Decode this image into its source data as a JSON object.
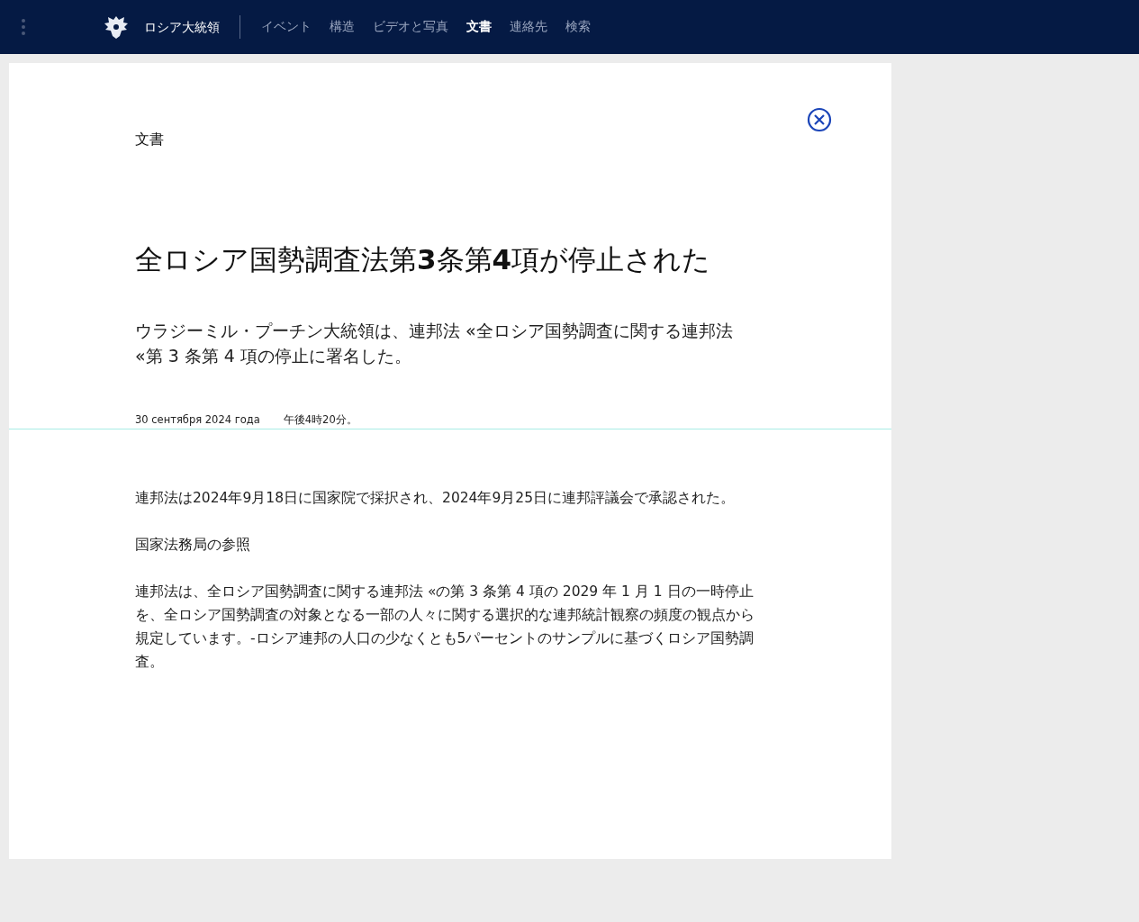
{
  "header": {
    "site_title": "ロシア大統領",
    "nav": [
      {
        "label": "イベント",
        "selected": false
      },
      {
        "label": "構造",
        "selected": false
      },
      {
        "label": "ビデオと写真",
        "selected": false
      },
      {
        "label": "文書",
        "selected": true
      },
      {
        "label": "連絡先",
        "selected": false
      },
      {
        "label": "検索",
        "selected": false
      }
    ]
  },
  "article": {
    "section": "文書",
    "title": "全ロシア国勢調査法第**3**条第**4**項が停止された",
    "lead": "ウラジーミル・プーチン大統領は、連邦法 «全ロシア国勢調査に関する連邦法 «第 3 条第 4 項の停止に署名した。",
    "date": "30 сентября 2024 года",
    "time": "午後4時20分。",
    "paragraphs": [
      "連邦法は2024年9月18日に国家院で採択され、2024年9月25日に連邦評議会で承認された。",
      "国家法務局の参照",
      "連邦法は、全ロシア国勢調査に関する連邦法 «の第 3 条第 4 項の 2029 年 1 月 1 日の一時停止を、全ロシア国勢調査の対象となる一部の人々に関する選択的な連邦統計観察の頻度の観点から規定しています。-ロシア連邦の人口の少なくとも5パーセントのサンプルに基づくロシア国勢調査。"
    ]
  }
}
